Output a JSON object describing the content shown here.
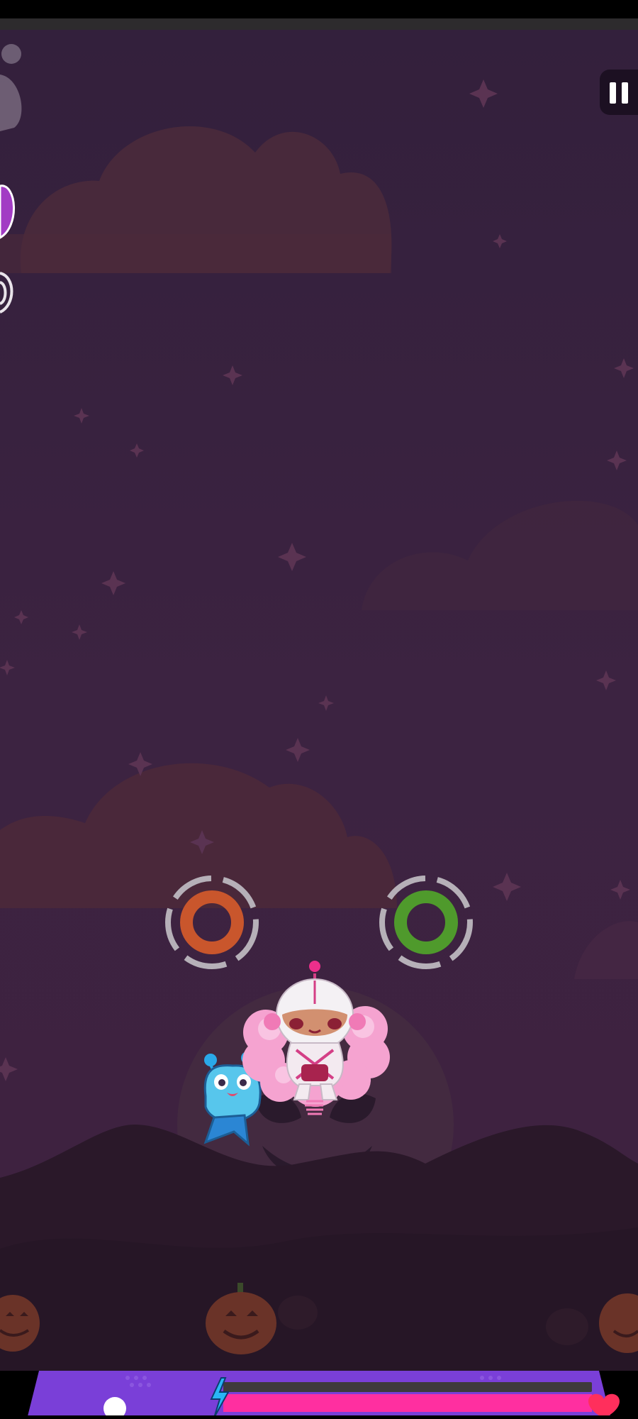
{
  "game": {
    "theme": "halloween-night",
    "paused": false
  },
  "hud": {
    "pause_icon": "pause-icon",
    "energy_icon": "lightning-icon",
    "health_icon": "heart-icon",
    "health_level": 0.97
  },
  "lanes": [
    {
      "name": "left-lane-target",
      "color": "#c9562c"
    },
    {
      "name": "right-lane-target",
      "color": "#4f9a2c"
    }
  ],
  "characters": {
    "player": "pink-haired-astronaut-girl",
    "companion": "blue-fish-buddy"
  },
  "colors": {
    "sky": "#3b2240",
    "cloud": "#5a2f3e",
    "mountain": "#261526",
    "hud_purple": "#7a3fd8",
    "hud_pink": "#ff2fa0"
  }
}
